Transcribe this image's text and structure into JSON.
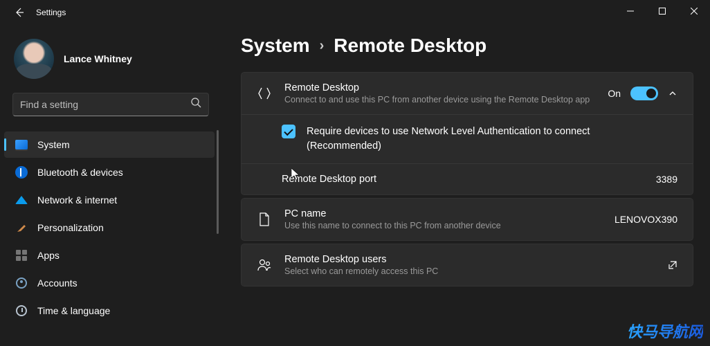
{
  "app": {
    "title": "Settings"
  },
  "user": {
    "name": "Lance Whitney"
  },
  "search": {
    "placeholder": "Find a setting"
  },
  "sidebar": {
    "items": [
      {
        "label": "System"
      },
      {
        "label": "Bluetooth & devices"
      },
      {
        "label": "Network & internet"
      },
      {
        "label": "Personalization"
      },
      {
        "label": "Apps"
      },
      {
        "label": "Accounts"
      },
      {
        "label": "Time & language"
      }
    ]
  },
  "breadcrumb": {
    "parent": "System",
    "page": "Remote Desktop"
  },
  "main": {
    "rd": {
      "title": "Remote Desktop",
      "desc": "Connect to and use this PC from another device using the Remote Desktop app",
      "state_label": "On"
    },
    "nla": {
      "label_line1": "Require devices to use Network Level Authentication to connect",
      "label_line2": "(Recommended)"
    },
    "port": {
      "label": "Remote Desktop port",
      "value": "3389"
    },
    "pcname": {
      "title": "PC name",
      "desc": "Use this name to connect to this PC from another device",
      "value": "LENOVOX390"
    },
    "users": {
      "title": "Remote Desktop users",
      "desc": "Select who can remotely access this PC"
    }
  },
  "watermark": "快马导航网"
}
